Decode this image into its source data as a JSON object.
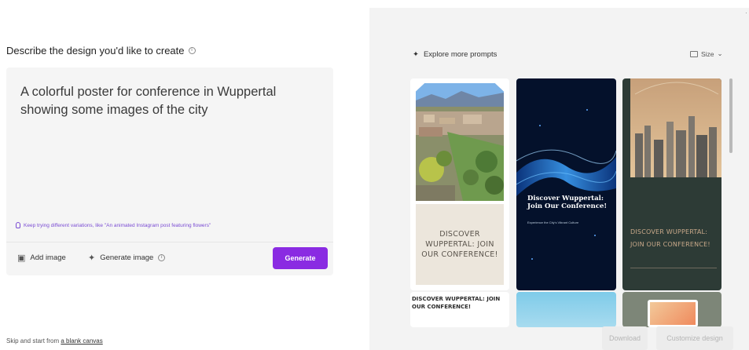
{
  "left": {
    "title": "Describe the design you'd like to create",
    "prompt_text": "A colorful poster for conference in Wuppertal showing some images of the city",
    "hint": "Keep trying different variations, like \"An animated Instagram post featuring flowers\"",
    "add_image_label": "Add image",
    "generate_image_label": "Generate image",
    "generate_button": "Generate",
    "skip_prefix": "Skip and start from",
    "skip_link": "a blank canvas"
  },
  "right": {
    "explore_label": "Explore more prompts",
    "size_label": "Size",
    "cards": [
      {
        "text": "DISCOVER WUPPERTAL: JOIN OUR CONFERENCE!"
      },
      {
        "title": "Discover Wuppertal: Join Our Conference!",
        "subtitle": "Experience the City's Vibrant Culture"
      },
      {
        "text": "DISCOVER WUPPERTAL: JOIN OUR CONFERENCE!"
      },
      {
        "text": "DISCOVER WUPPERTAL: JOIN OUR CONFERENCE!"
      }
    ],
    "download_label": "Download",
    "customize_label": "Customize design"
  },
  "colors": {
    "accent": "#8a2be2",
    "hint": "#7a4bd3",
    "pane_bg": "#f3f3f3"
  },
  "icons": {
    "info": "info-icon",
    "hint": "lightbulb-icon",
    "add_image": "add-image-icon",
    "generate_image": "sparkle-icon",
    "explore": "sparkle-icon",
    "size": "resize-icon",
    "close": "close-icon"
  }
}
